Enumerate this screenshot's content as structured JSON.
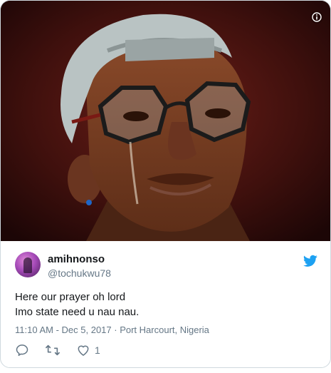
{
  "tweet": {
    "author": {
      "name": "amihnonso",
      "handle": "@tochukwu78",
      "avatar_icon": "avatar-person"
    },
    "text_lines": [
      "Here our prayer oh lord",
      "Imo state need u nau nau."
    ],
    "meta": {
      "time": "11:10 AM",
      "separator1": " - ",
      "date": "Dec 5, 2017",
      "separator2": " · ",
      "location": "Port Harcourt, Nigeria"
    },
    "actions": {
      "reply_icon": "reply-icon",
      "retweet_icon": "retweet-icon",
      "like_icon": "heart-icon",
      "like_count": "1"
    },
    "media": {
      "info_icon": "info-icon",
      "description_icon": "photo"
    }
  },
  "colors": {
    "twitter_blue": "#1da1f2",
    "text": "#14171a",
    "secondary": "#657786",
    "border": "#cfd9de"
  }
}
